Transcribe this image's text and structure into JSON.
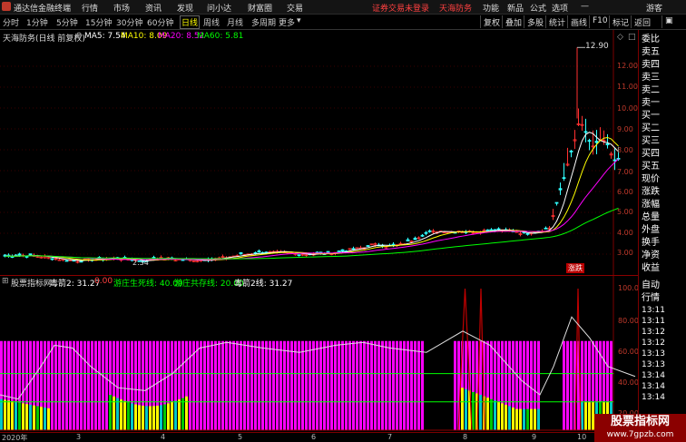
{
  "titlebar": {
    "app_name": "通达信金融终端",
    "menus": [
      "行情",
      "市场",
      "资讯",
      "发现",
      "问小达",
      "财富圈",
      "交易"
    ],
    "notice": "证券交易未登录",
    "stock": "天海防务",
    "right_menus": [
      "功能",
      "新品",
      "公式",
      "选项"
    ],
    "user": "游客"
  },
  "toolbar": {
    "periods": [
      "分时",
      "1分钟",
      "5分钟",
      "15分钟",
      "30分钟",
      "60分钟",
      "日线",
      "周线",
      "月线",
      "多周期",
      "更多"
    ],
    "active": "日线",
    "right_buttons": [
      "复权",
      "叠加",
      "多股",
      "统计",
      "画线",
      "F10",
      "标记",
      "返回"
    ]
  },
  "main_header": {
    "title": "天海防务(日线 前复权)",
    "ma5": "MA5: 7.54",
    "ma10": "MA10: 8.09",
    "ma20": "MA20: 8.52",
    "ma60": "MA60: 5.81",
    "colors": {
      "ma5": "#ffffff",
      "ma10": "#ffff00",
      "ma20": "#ff00ff",
      "ma60": "#00ff00"
    }
  },
  "price_axis": [
    "12.00",
    "11.00",
    "10.00",
    "9.00",
    "8.00",
    "7.00",
    "6.00",
    "5.00",
    "4.00",
    "3.00"
  ],
  "peak_label": "12.90",
  "low_label": "2.34",
  "zhangdie_label": "涨跌",
  "indicator_header": {
    "name": "股票指标网",
    "v1": "毒箭2: 31.27",
    "v2": "0.00",
    "v3": "游庄生死线: 40.00",
    "v4": "游庄共存线: 20.00",
    "v5": "毒箭2线: 31.27"
  },
  "indicator_axis": [
    "100.0",
    "80.00",
    "60.00",
    "40.00",
    "20.00"
  ],
  "date_axis": [
    "2020年",
    "3",
    "4",
    "5",
    "6",
    "7",
    "8",
    "9",
    "10"
  ],
  "side_panel": {
    "items": [
      "委比",
      "卖五",
      "卖四",
      "卖三",
      "卖二",
      "卖一",
      "买一",
      "买二",
      "买三",
      "买四",
      "买五",
      "现价",
      "涨跌",
      "涨幅",
      "总量",
      "外盘",
      "换手",
      "净资",
      "收益",
      "自动",
      "行情"
    ],
    "times": [
      "13:11",
      "13:11",
      "13:12",
      "13:12",
      "13:13",
      "13:13",
      "13:14",
      "13:14",
      "13:14"
    ]
  },
  "logo": {
    "name": "股票指标网",
    "url": "www.7gpzb.com"
  },
  "chart_data": {
    "type": "bar",
    "title": "毒箭2",
    "ylim": [
      0,
      100
    ],
    "segments": [
      {
        "name": "magenta",
        "color": "#ff00ff"
      },
      {
        "name": "yellow",
        "color": "#ffff00"
      },
      {
        "name": "cyan",
        "color": "#00c8c8"
      },
      {
        "name": "green",
        "color": "#00c800"
      }
    ]
  }
}
